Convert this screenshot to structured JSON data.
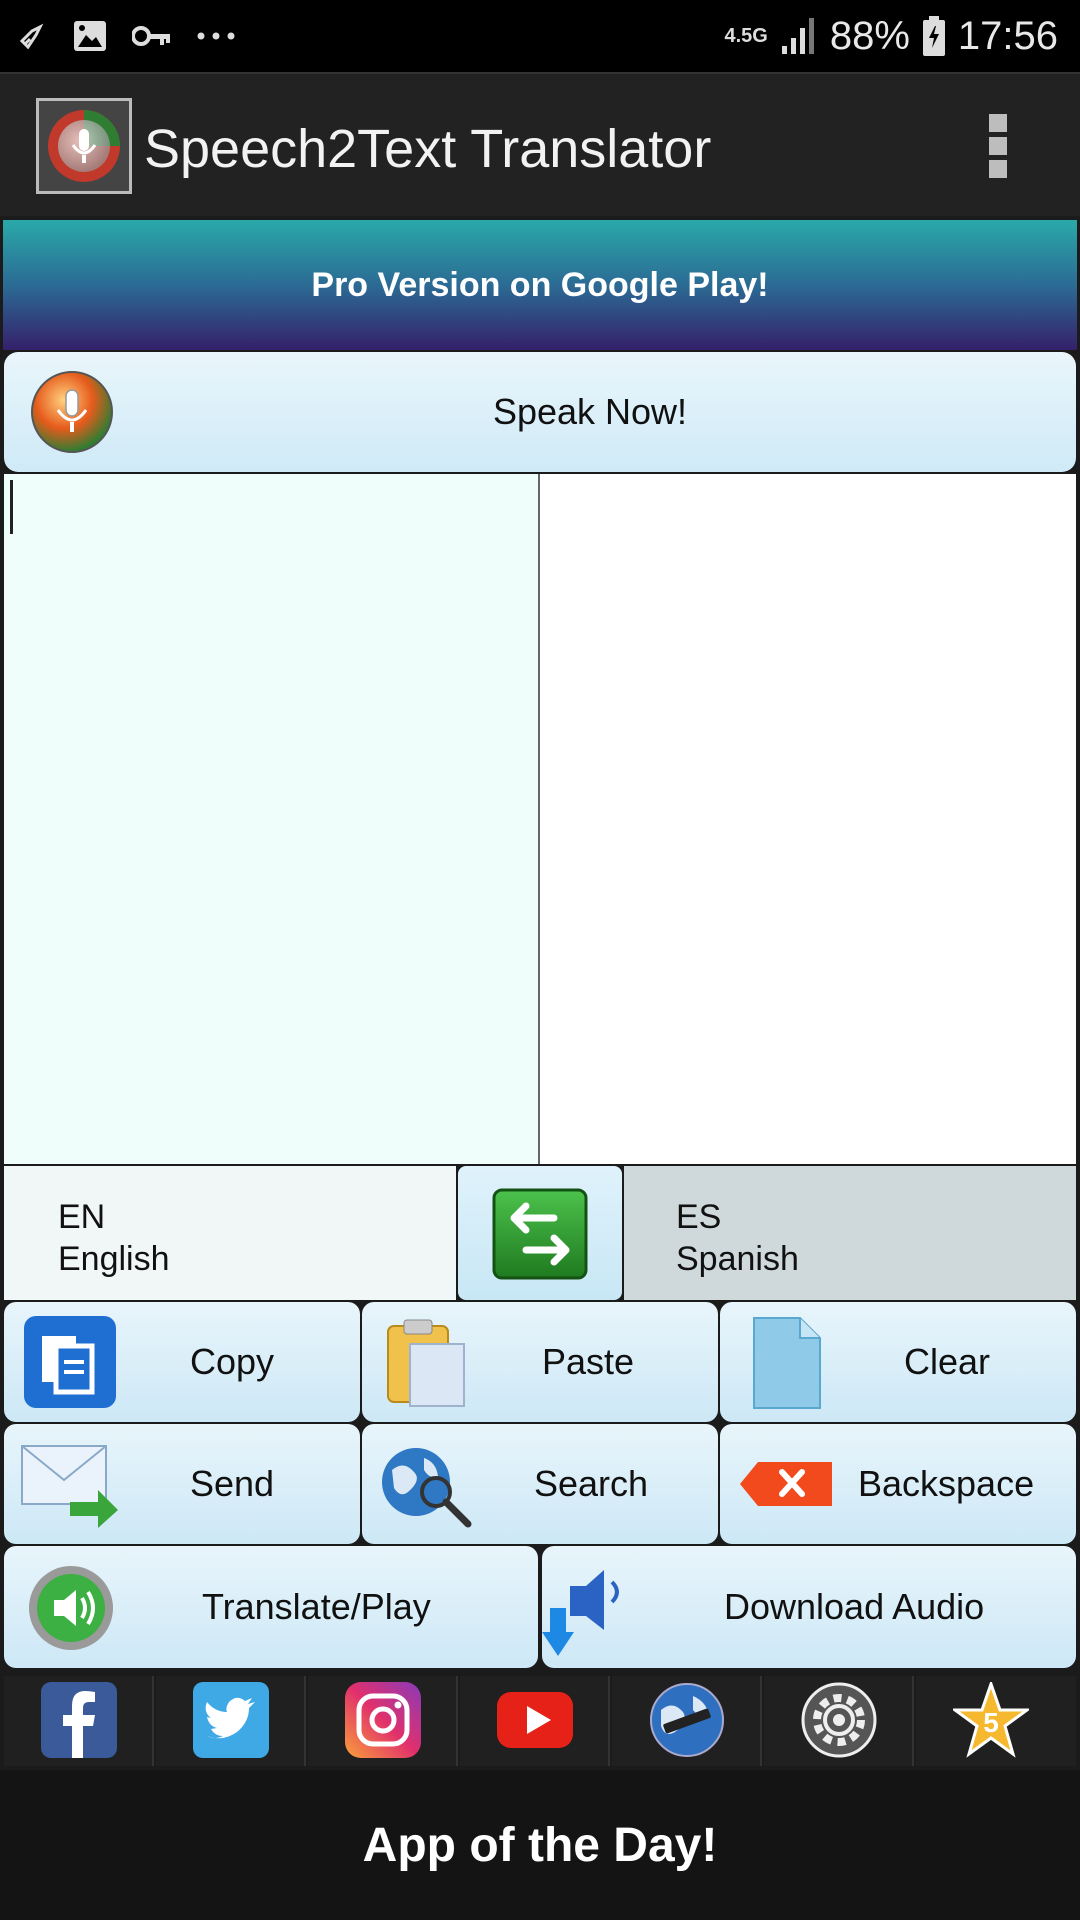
{
  "status_bar": {
    "network": "4.5G",
    "battery": "88%",
    "time": "17:56"
  },
  "app_bar": {
    "title": "Speech2Text Translator"
  },
  "promo": {
    "label": "Pro Version on Google Play!"
  },
  "speak_button": {
    "label": "Speak Now!"
  },
  "languages": {
    "source_code": "EN",
    "source_name": "English",
    "target_code": "ES",
    "target_name": "Spanish"
  },
  "actions": {
    "copy": "Copy",
    "paste": "Paste",
    "clear": "Clear",
    "send": "Send",
    "search": "Search",
    "backspace": "Backspace",
    "translate_play": "Translate/Play",
    "download_audio": "Download Audio"
  },
  "social": [
    "facebook-icon",
    "twitter-icon",
    "instagram-icon",
    "youtube-icon",
    "web-globe-icon",
    "settings-gear-icon",
    "rate-star-icon"
  ],
  "footer": {
    "label": "App of the Day!"
  },
  "colors": {
    "button_top": "#e8f5fb",
    "button_bottom": "#cde8f6",
    "promo_top": "#2aa9a9",
    "promo_bottom": "#35206b"
  }
}
